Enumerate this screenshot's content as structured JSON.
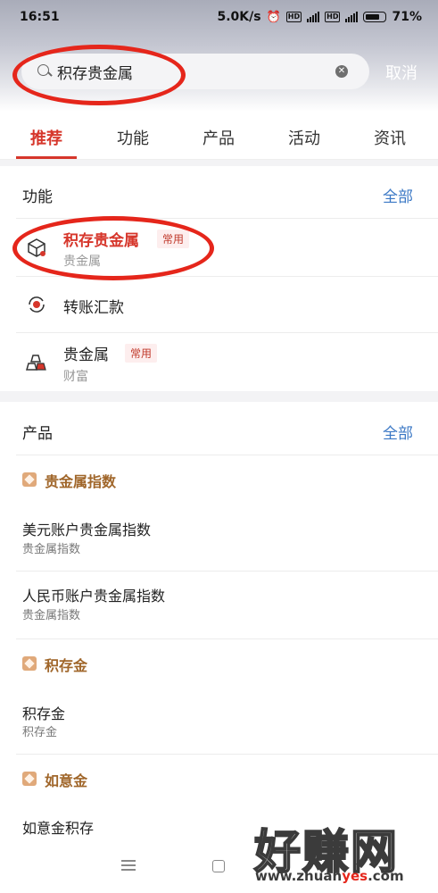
{
  "status": {
    "time": "16:51",
    "net_speed": "5.0K/s",
    "battery": "71%"
  },
  "search": {
    "query": "积存贵金属",
    "cancel_label": "取消"
  },
  "tabs": [
    {
      "label": "推荐",
      "active": true
    },
    {
      "label": "功能",
      "active": false
    },
    {
      "label": "产品",
      "active": false
    },
    {
      "label": "活动",
      "active": false
    },
    {
      "label": "资讯",
      "active": false
    }
  ],
  "functions": {
    "title": "功能",
    "more": "全部",
    "items": [
      {
        "title": "积存贵金属",
        "tag": "常用",
        "sub": "贵金属",
        "icon": "box-icon"
      },
      {
        "title": "转账汇款",
        "tag": "",
        "sub": "",
        "icon": "transfer-icon"
      },
      {
        "title": "贵金属",
        "tag": "常用",
        "sub": "财富",
        "icon": "gold-bars-icon"
      }
    ]
  },
  "products": {
    "title": "产品",
    "more": "全部",
    "categories": [
      {
        "name": "贵金属指数",
        "items": [
          {
            "title": "美元账户贵金属指数",
            "sub": "贵金属指数"
          },
          {
            "title": "人民币账户贵金属指数",
            "sub": "贵金属指数"
          }
        ]
      },
      {
        "name": "积存金",
        "items": [
          {
            "title": "积存金",
            "sub": "积存金"
          }
        ]
      },
      {
        "name": "如意金",
        "items": [
          {
            "title": "如意金积存",
            "sub": ""
          }
        ]
      }
    ]
  },
  "watermark": {
    "big": "好赚网",
    "small_pre": "www.zhuan",
    "small_mid": "yes",
    "small_post": ".com"
  },
  "colors": {
    "accent_red": "#d6362b",
    "link_blue": "#3b78c5",
    "category_brown": "#a0662a",
    "annotation_red": "#e5261b"
  }
}
